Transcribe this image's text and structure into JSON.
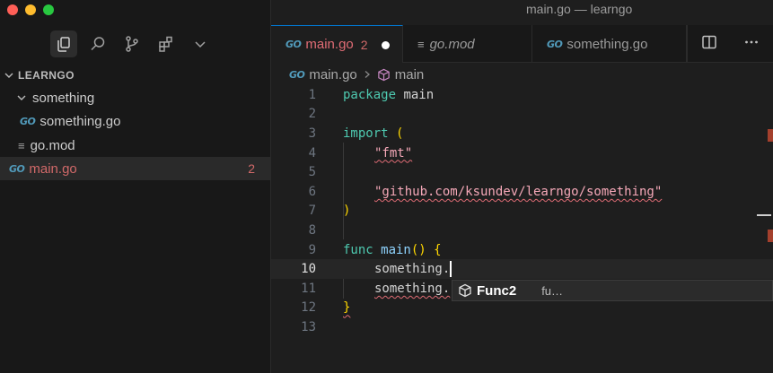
{
  "window": {
    "title": "main.go — learngo"
  },
  "explorer": {
    "section_title": "LEARNGO",
    "tree": [
      {
        "label": "something",
        "type": "folder"
      },
      {
        "label": "something.go",
        "type": "go-file"
      },
      {
        "label": "go.mod",
        "type": "mod-file"
      },
      {
        "label": "main.go",
        "type": "go-file",
        "badge": "2"
      }
    ]
  },
  "tabs": [
    {
      "label": "main.go",
      "count": "2"
    },
    {
      "label": "go.mod"
    },
    {
      "label": "something.go"
    }
  ],
  "breadcrumb": {
    "file": "main.go",
    "symbol": "main"
  },
  "icon_text": {
    "go": "GO",
    "mod": "≡"
  },
  "editor": {
    "line_numbers": [
      "1",
      "2",
      "3",
      "4",
      "5",
      "6",
      "7",
      "8",
      "9",
      "10",
      "11",
      "12",
      "13"
    ],
    "code": {
      "l1_kw": "package",
      "l1_name": " main",
      "l3_kw": "import",
      "l3_paren": " (",
      "l4_str": "\"fmt\"",
      "l6_str": "\"github.com/ksundev/learngo/something\"",
      "l7_paren": ")",
      "l9_kw": "func",
      "l9_name": " main",
      "l9_parens": "()",
      "l9_brace": " {",
      "l10_text": "something.",
      "l11_text": "something.",
      "l12_brace": "}"
    }
  },
  "suggestion": {
    "name": "Func2",
    "detail": "fu…"
  },
  "colors": {
    "accent": "#0078d4",
    "error": "#d16969",
    "keyword": "#4ec9b0",
    "string": "#f5a8b8"
  }
}
